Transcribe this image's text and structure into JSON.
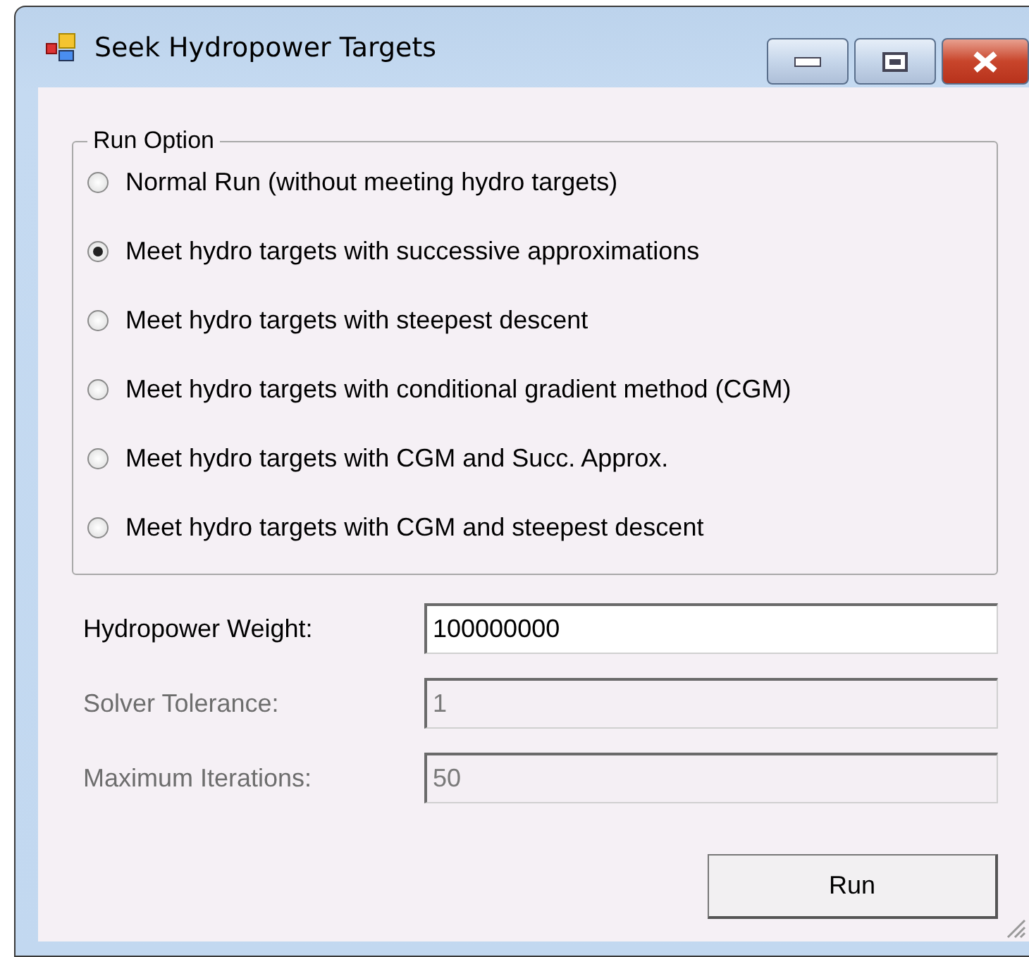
{
  "window": {
    "title": "Seek Hydropower Targets"
  },
  "run_option": {
    "title": "Run Option",
    "options": [
      {
        "label": "Normal Run (without meeting hydro targets)",
        "selected": false
      },
      {
        "label": "Meet hydro targets with successive approximations",
        "selected": true
      },
      {
        "label": "Meet hydro targets with steepest descent",
        "selected": false
      },
      {
        "label": "Meet hydro targets with conditional gradient method (CGM)",
        "selected": false
      },
      {
        "label": "Meet hydro targets with CGM and Succ. Approx.",
        "selected": false
      },
      {
        "label": "Meet hydro targets with CGM and steepest descent",
        "selected": false
      }
    ]
  },
  "fields": [
    {
      "label": "Hydropower Weight:",
      "value": "100000000",
      "disabled": false
    },
    {
      "label": "Solver Tolerance:",
      "value": "1",
      "disabled": true
    },
    {
      "label": "Maximum Iterations:",
      "value": "50",
      "disabled": true
    }
  ],
  "buttons": [
    "Run"
  ]
}
